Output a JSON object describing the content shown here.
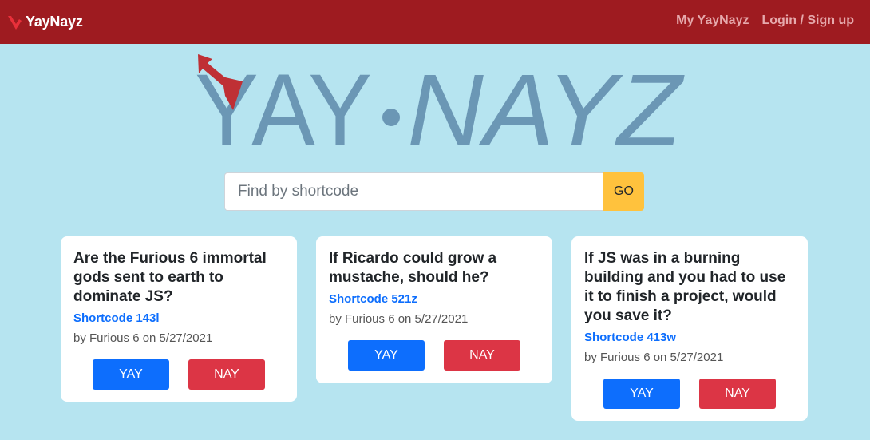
{
  "navbar": {
    "brand": "YayNayz",
    "links": [
      "My YayNayz",
      "Login / Sign up"
    ]
  },
  "logo": {
    "left_word": "YAY",
    "right_word": "NAYZ",
    "colors": {
      "text": "#6b97b5",
      "arrow": "#bf3035",
      "background": "#b6e4f0"
    }
  },
  "search": {
    "placeholder": "Find by shortcode",
    "value": "",
    "button_label": "GO"
  },
  "cards": [
    {
      "question": "Are the Furious 6 immortal gods sent to earth to dominate JS?",
      "shortcode": "Shortcode 143l",
      "meta": "by Furious 6 on 5/27/2021",
      "yay_label": "YAY",
      "nay_label": "NAY"
    },
    {
      "question": "If Ricardo could grow a mustache, should he?",
      "shortcode": "Shortcode 521z",
      "meta": "by Furious 6 on 5/27/2021",
      "yay_label": "YAY",
      "nay_label": "NAY"
    },
    {
      "question": "If JS was in a burning building and you had to use it to finish a project, would you save it?",
      "shortcode": "Shortcode 413w",
      "meta": "by Furious 6 on 5/27/2021",
      "yay_label": "YAY",
      "nay_label": "NAY"
    }
  ],
  "colors": {
    "navbar": "#9e1b20",
    "page_background": "#b6e4f0",
    "yay_button": "#0d6efd",
    "nay_button": "#dc3545",
    "go_button": "#ffc23d",
    "shortcode_link": "#0d6efd"
  }
}
